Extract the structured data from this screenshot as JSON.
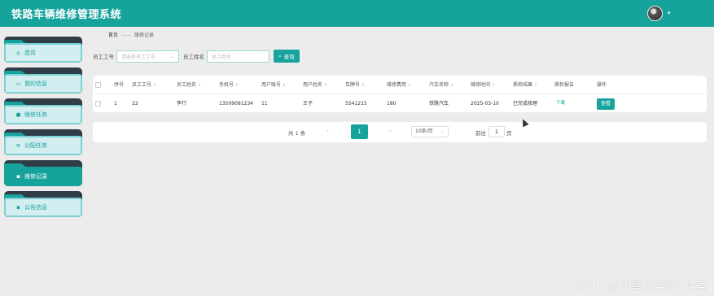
{
  "header": {
    "app_title": "铁路车辆维修管理系统",
    "accent_color": "#16a39c",
    "avatar_caret": "▾"
  },
  "sidebar": {
    "items": [
      {
        "label": "首页",
        "icon": "home-icon",
        "glyph": "⌂",
        "active": false
      },
      {
        "label": "我的信息",
        "icon": "id-card-icon",
        "glyph": "▭",
        "active": false
      },
      {
        "label": "维修任务",
        "icon": "pin-icon",
        "glyph": "●",
        "active": false
      },
      {
        "label": "分配任务",
        "icon": "list-icon",
        "glyph": "≡",
        "active": false
      },
      {
        "label": "维修记录",
        "icon": "grid-icon",
        "glyph": "▪",
        "active": true
      },
      {
        "label": "公告信息",
        "icon": "grid-icon",
        "glyph": "▪",
        "active": false
      }
    ]
  },
  "breadcrumb": {
    "home": "首页",
    "separator": "——",
    "current": "维修记录"
  },
  "search": {
    "employee_no_label": "员工工号",
    "employee_no_placeholder": "请选择员工工号",
    "employee_name_label": "员工姓名",
    "employee_name_placeholder": "员工姓名",
    "search_button": "查询",
    "search_icon_glyph": "⌕"
  },
  "table": {
    "columns": [
      "序号",
      "员工工号",
      "员工姓名",
      "手机号",
      "用户账号",
      "用户姓名",
      "车牌号",
      "维修费用",
      "汽车名称",
      "维修时间",
      "质检结果",
      "质检报告",
      "操作"
    ],
    "sortable": [
      false,
      true,
      true,
      true,
      true,
      true,
      true,
      true,
      true,
      true,
      true,
      false,
      false
    ],
    "sort_glyph": "⇕",
    "rows": [
      {
        "index": "1",
        "employee_no": "22",
        "employee_name": "李行",
        "phone": "13509091234",
        "user_account": "11",
        "user_name": "王子",
        "plate": "5541215",
        "fee": "180",
        "car_name": "铁路汽车",
        "repair_time": "2025-03-10",
        "qc_result": "已完成修理",
        "qc_report": "下载",
        "action": "查看"
      }
    ]
  },
  "pagination": {
    "total": "共 1 条",
    "prev": "‹",
    "current_page": "1",
    "next": "›",
    "page_size": "10条/页",
    "page_size_caret": "⌄",
    "goto_label": "前往",
    "goto_value": "1",
    "page_suffix": "页"
  },
  "watermark": "CSDN @计算机毕设工作室"
}
